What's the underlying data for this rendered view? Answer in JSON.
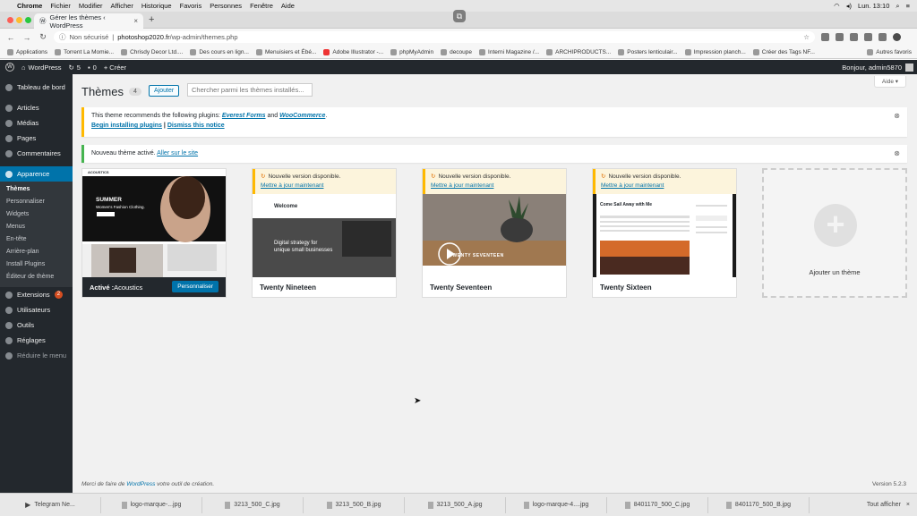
{
  "mac": {
    "app": "Chrome",
    "menus": [
      "Fichier",
      "Modifier",
      "Afficher",
      "Historique",
      "Favoris",
      "Personnes",
      "Fenêtre",
      "Aide"
    ],
    "clock": "Lun. 13:10"
  },
  "tab": {
    "title": "Gérer les thèmes ‹ WordPress"
  },
  "address": {
    "security": "Non sécurisé",
    "host": "photoshop2020.fr",
    "path": "/wp-admin/themes.php"
  },
  "bookmarks": [
    "Applications",
    "Torrent La Momie...",
    "Chrisdy Decor Ltd....",
    "Des cours en lign...",
    "Menuisiers et Ébé...",
    "Adobe Illustrator -...",
    "phpMyAdmin",
    "decoupe",
    "Interni Magazine /...",
    "ARCHIPRODUCTS...",
    "Posters lenticulair...",
    "Impression planch...",
    "Créer des Tags NF..."
  ],
  "bookmarks_other": "Autres favoris",
  "adminbar": {
    "site": "WordPress",
    "updates": "5",
    "comments": "0",
    "new": "+ Créer",
    "howdy": "Bonjour, admin5870"
  },
  "menu": {
    "dashboard": "Tableau de bord",
    "posts": "Articles",
    "media": "Médias",
    "pages": "Pages",
    "comments": "Commentaires",
    "appearance": "Apparence",
    "sub": [
      "Thèmes",
      "Personnaliser",
      "Widgets",
      "Menus",
      "En-tête",
      "Arrière-plan",
      "Install Plugins",
      "Éditeur de thème"
    ],
    "plugins": "Extensions",
    "plugins_badge": "2",
    "users": "Utilisateurs",
    "tools": "Outils",
    "settings": "Réglages",
    "collapse": "Réduire le menu"
  },
  "page": {
    "title": "Thèmes",
    "count": "4",
    "add": "Ajouter",
    "search_placeholder": "Chercher parmi les thèmes installés...",
    "help": "Aide ▾"
  },
  "notice1": {
    "text1": "This theme recommends the following plugins: ",
    "link1": "Everest Forms",
    "and": " and ",
    "link2": "WooCommerce",
    "end": ".",
    "action1": "Begin installing plugins",
    "sep": " | ",
    "action2": "Dismiss this notice"
  },
  "notice2": {
    "text": "Nouveau thème activé. ",
    "link": "Aller sur le site"
  },
  "themes": [
    {
      "name": "Acoustics",
      "active_label": "Activé : ",
      "button": "Personnaliser",
      "shot": {
        "brand": "ACOUSTICS",
        "hero1": "SUMMER",
        "hero2": "Women's Fashion Clothing."
      }
    },
    {
      "name": "Twenty Nineteen",
      "update": "Nouvelle version disponible.",
      "update_link": "Mettre à jour maintenant",
      "shot": {
        "h": "Welcome",
        "t1": "Digital strategy for",
        "t2": "unique small businesses"
      }
    },
    {
      "name": "Twenty Seventeen",
      "update": "Nouvelle version disponible.",
      "update_link": "Mettre à jour maintenant",
      "shot": {
        "h": "TWENTY SEVENTEEN"
      }
    },
    {
      "name": "Twenty Sixteen",
      "update": "Nouvelle version disponible.",
      "update_link": "Mettre à jour maintenant",
      "shot": {
        "h": "Come Sail Away with Me"
      }
    }
  ],
  "add_theme": "Ajouter un thème",
  "footer": {
    "text1": "Merci de faire de ",
    "link": "WordPress",
    "text2": " votre outil de création.",
    "version": "Version 5.2.3"
  },
  "downloads": [
    "Telegram Ne...",
    "logo-marque-...jpg",
    "3213_500_C.jpg",
    "3213_500_B.jpg",
    "3213_500_A.jpg",
    "logo-marque-4....jpg",
    "8401170_500_C.jpg",
    "8401170_500_B.jpg"
  ],
  "show_all": "Tout afficher",
  "colors": {
    "admin_dark": "#23282d",
    "wp_blue": "#0073aa",
    "notice_warn": "#ffb900",
    "notice_ok": "#46b450"
  }
}
